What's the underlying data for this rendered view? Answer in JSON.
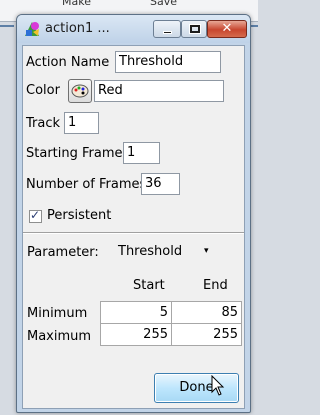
{
  "background": {
    "left_tab": "Make",
    "right_tab": "Save"
  },
  "window": {
    "title": "action1 ...",
    "close_glyph": "✕"
  },
  "form": {
    "action_name_label": "Action Name",
    "action_name_value": "Threshold",
    "color_label": "Color",
    "color_value": "Red",
    "track_label": "Track",
    "track_value": "1",
    "starting_frame_label": "Starting Frame",
    "starting_frame_value": "1",
    "num_frames_label": "Number of Frames",
    "num_frames_value": "36",
    "persistent_label": "Persistent",
    "persistent_checked": true
  },
  "parameter": {
    "label": "Parameter:",
    "selected": "Threshold",
    "arrow": "▾"
  },
  "grid": {
    "col_start": "Start",
    "col_end": "End",
    "rows": [
      {
        "label": "Minimum",
        "start": "5",
        "end": "85"
      },
      {
        "label": "Maximum",
        "start": "255",
        "end": "255"
      }
    ]
  },
  "done_label": "Done",
  "colors": {
    "accent": "#3c7fb1",
    "close": "#c8462f",
    "title_bg": "#c2d4e8"
  }
}
